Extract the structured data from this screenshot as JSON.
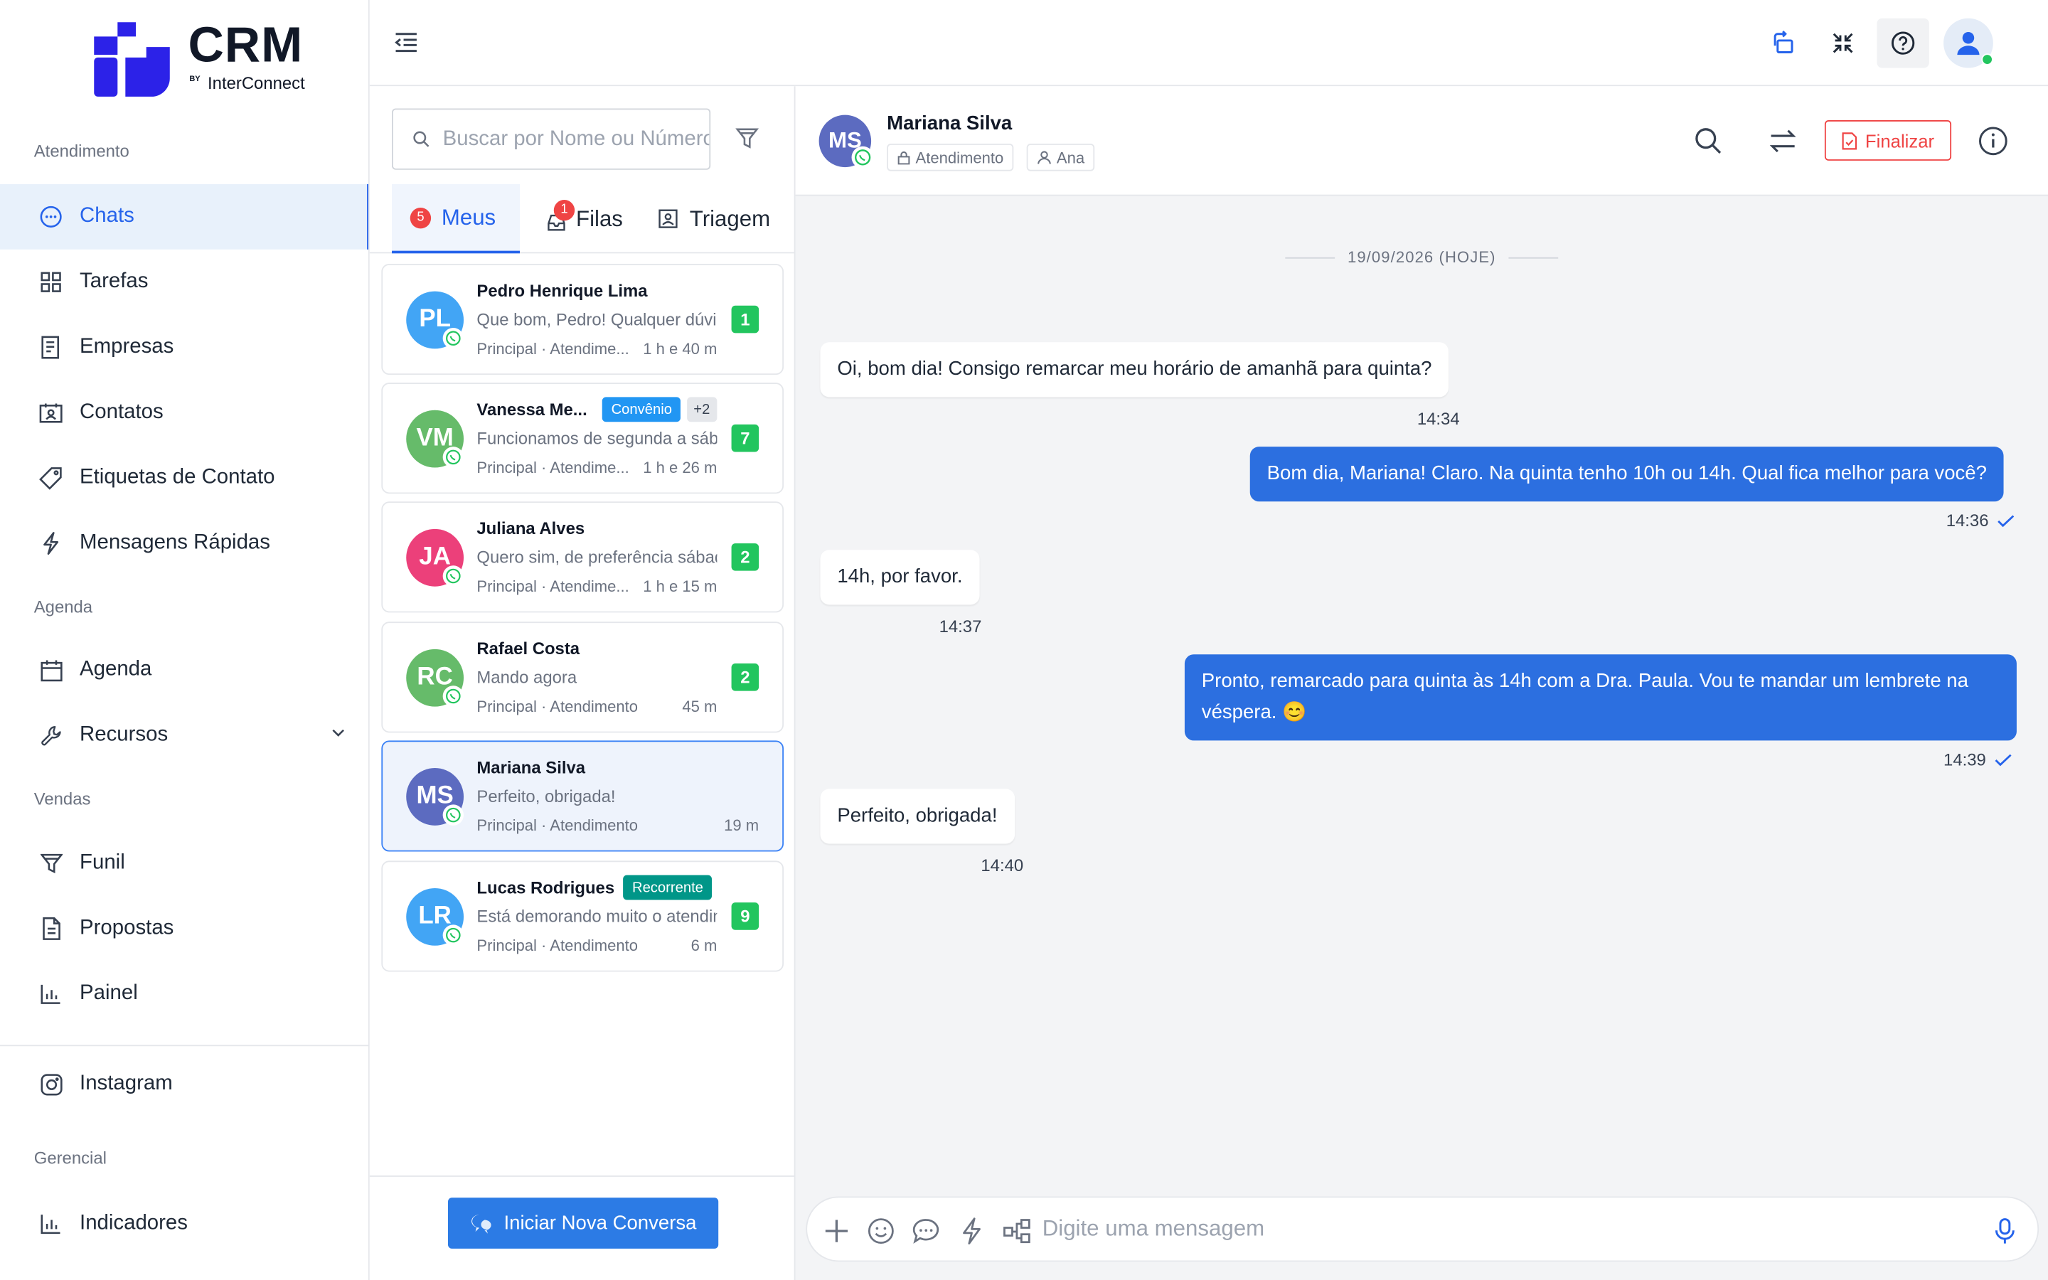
{
  "brand": {
    "logo_text": "CRM",
    "by": "BY",
    "company": "InterConnect",
    "primary_color": "#2563eb"
  },
  "sidebar": {
    "sections": [
      {
        "label": "Atendimento"
      },
      {
        "label": "Agenda"
      },
      {
        "label": "Vendas"
      },
      {
        "label": "Gerencial"
      }
    ],
    "items": [
      {
        "label": "Chats",
        "icon": "chat-bubble-icon",
        "active": true
      },
      {
        "label": "Tarefas",
        "icon": "grid-icon"
      },
      {
        "label": "Empresas",
        "icon": "building-doc-icon"
      },
      {
        "label": "Contatos",
        "icon": "contact-card-icon"
      },
      {
        "label": "Etiquetas de Contato",
        "icon": "tag-icon"
      },
      {
        "label": "Mensagens Rápidas",
        "icon": "lightning-icon"
      },
      {
        "label": "Agenda",
        "icon": "calendar-icon"
      },
      {
        "label": "Recursos",
        "icon": "wrench-icon"
      },
      {
        "label": "Funil",
        "icon": "funnel-icon"
      },
      {
        "label": "Propostas",
        "icon": "document-icon"
      },
      {
        "label": "Painel",
        "icon": "bar-chart-icon"
      },
      {
        "label": "Instagram",
        "icon": "instagram-icon"
      },
      {
        "label": "Indicadores",
        "icon": "bar-chart-icon"
      }
    ]
  },
  "topbar": {
    "icons": [
      "menu-collapse-icon",
      "sync-icon",
      "fullscreen-icon",
      "help-icon",
      "user-avatar-icon"
    ]
  },
  "convlist": {
    "search_placeholder": "Buscar por Nome ou Número",
    "tabs": [
      {
        "label": "Meus",
        "badge": "5",
        "active": true
      },
      {
        "label": "Filas",
        "badge": "1"
      },
      {
        "label": "Triagem"
      }
    ],
    "items": [
      {
        "initials": "PL",
        "color": "#42a5f5",
        "name": "Pedro Henrique Lima",
        "message": "Que bom, Pedro! Qualquer dúvida é só chamar",
        "meta": "Principal · Atendime...",
        "time": "1 h e 40 m",
        "unread": "1"
      },
      {
        "initials": "VM",
        "color": "#66bb6a",
        "name": "Vanessa Me...",
        "tag": "Convênio",
        "tag_color": "#2196f3",
        "extra_tags": "+2",
        "message": "Funcionamos de segunda a sábado",
        "meta": "Principal · Atendime...",
        "time": "1 h e 26 m",
        "unread": "7"
      },
      {
        "initials": "JA",
        "color": "#ec407a",
        "name": "Juliana Alves",
        "message": "Quero sim, de preferência sábado",
        "meta": "Principal · Atendime...",
        "time": "1 h e 15 m",
        "unread": "2"
      },
      {
        "initials": "RC",
        "color": "#66bb6a",
        "name": "Rafael Costa",
        "message": "Mando agora",
        "meta": "Principal · Atendimento",
        "time": "45 m",
        "unread": "2"
      },
      {
        "initials": "MS",
        "color": "#5c6bc0",
        "name": "Mariana Silva",
        "message": "Perfeito, obrigada!",
        "meta": "Principal · Atendimento",
        "time": "19 m",
        "selected": true
      },
      {
        "initials": "LR",
        "color": "#42a5f5",
        "name": "Lucas Rodrigues",
        "tag": "Recorrente",
        "tag_color": "#009688",
        "message": "Está demorando muito o atendimento",
        "meta": "Principal · Atendimento",
        "time": "6 m",
        "unread": "9"
      }
    ],
    "new_conversation": "Iniciar Nova Conversa"
  },
  "chat": {
    "contact": {
      "initials": "MS",
      "name": "Mariana Silva",
      "status_chip": "Atendimento",
      "agent_chip": "Ana"
    },
    "finalize_label": "Finalizar",
    "date_separator": "19/09/2026 (HOJE)",
    "messages": [
      {
        "dir": "in",
        "text": "Oi, bom dia! Consigo remarcar meu horário de amanhã para quinta?",
        "time": "14:34"
      },
      {
        "dir": "out",
        "text": "Bom dia, Mariana! Claro. Na quinta tenho 10h ou 14h. Qual fica melhor para você?",
        "time": "14:36"
      },
      {
        "dir": "in",
        "text": "14h, por favor.",
        "time": "14:37"
      },
      {
        "dir": "out",
        "text": "Pronto, remarcado para quinta às 14h com a Dra. Paula. Vou te mandar um lembrete na véspera. 😊",
        "time": "14:39"
      },
      {
        "dir": "in",
        "text": "Perfeito, obrigada!",
        "time": "14:40"
      }
    ],
    "composer_placeholder": "Digite uma mensagem"
  }
}
